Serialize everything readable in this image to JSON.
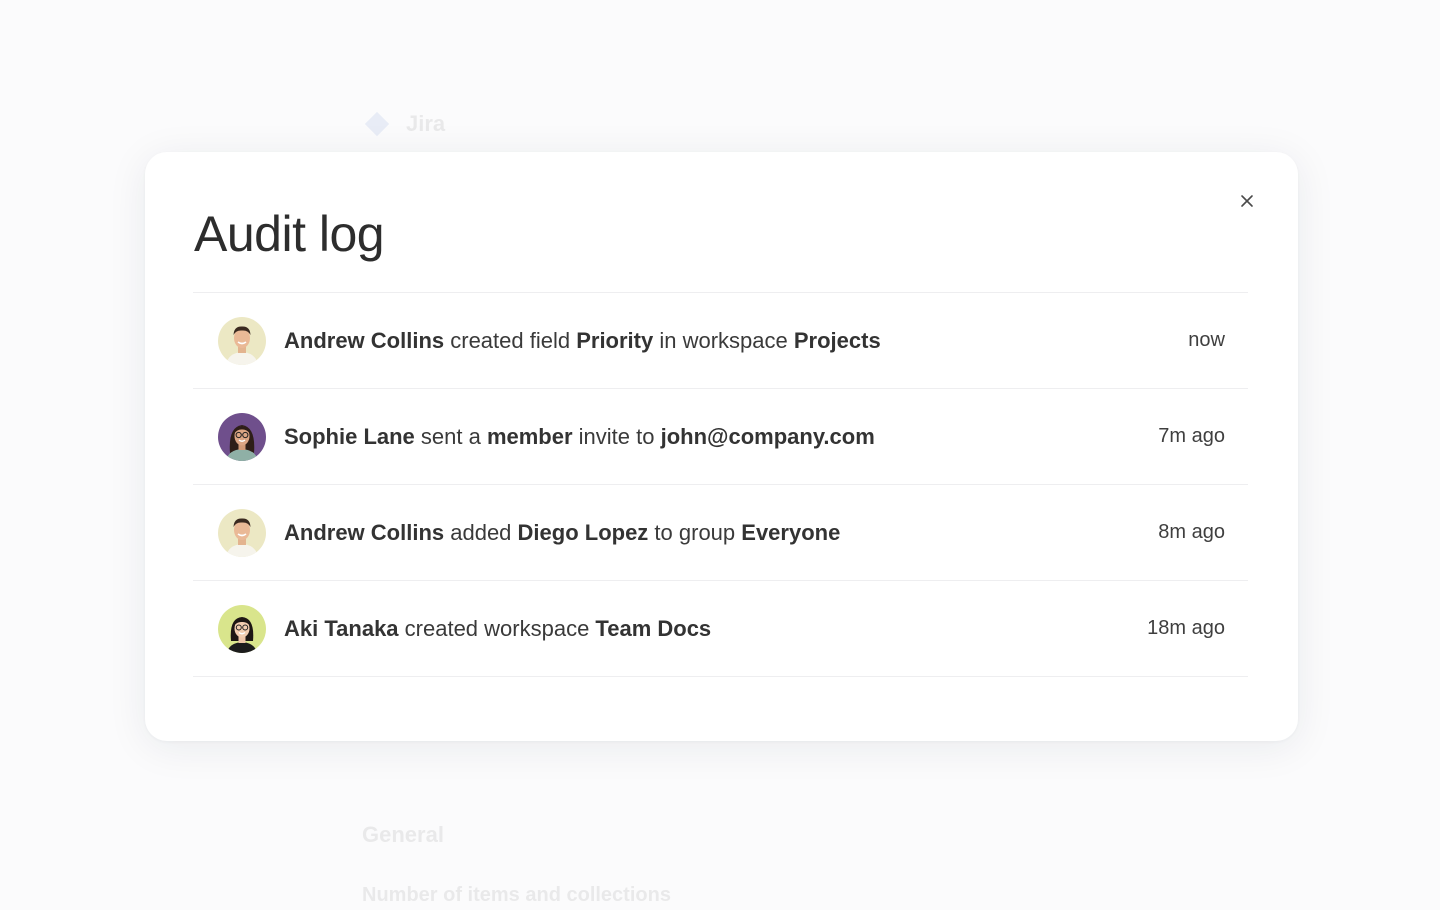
{
  "background": {
    "app_name": "Jira",
    "app_meta": "",
    "section_title": "General",
    "stat_label": "Number of items and collections",
    "stat_value": ""
  },
  "modal": {
    "title": "Audit log",
    "close_icon": "close-icon",
    "entries": [
      {
        "avatar": "andrew-collins-avatar",
        "avatar_bg": "#ece8c4",
        "actor": "Andrew Collins",
        "verb1": " created field ",
        "object1": "Priority",
        "verb2": " in workspace ",
        "object2": "Projects",
        "time": "now"
      },
      {
        "avatar": "sophie-lane-avatar",
        "avatar_bg": "#6f4f8c",
        "actor": "Sophie Lane",
        "verb1": " sent a ",
        "object1": "member",
        "verb2": " invite to ",
        "object2": "john@company.com",
        "time": "7m ago"
      },
      {
        "avatar": "andrew-collins-avatar",
        "avatar_bg": "#ece8c4",
        "actor": "Andrew Collins",
        "verb1": " added ",
        "object1": "Diego Lopez",
        "verb2": " to group ",
        "object2": "Everyone",
        "time": "8m ago"
      },
      {
        "avatar": "aki-tanaka-avatar",
        "avatar_bg": "#d9e58c",
        "actor": "Aki Tanaka",
        "verb1": " created workspace ",
        "object1": "Team Docs",
        "verb2": "",
        "object2": "",
        "time": "18m ago"
      }
    ]
  },
  "colors": {
    "page_bg": "#fbfbfc",
    "modal_bg": "#ffffff",
    "divider": "#eeeef0",
    "text": "#3a3a3a"
  }
}
